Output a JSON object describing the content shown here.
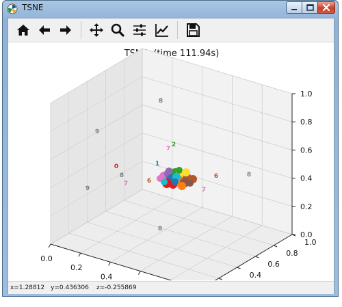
{
  "window": {
    "title": "TSNE",
    "app_icon": "matplotlib-icon",
    "controls": [
      "minimize-icon",
      "maximize-icon",
      "close-icon"
    ]
  },
  "toolbar": {
    "buttons": [
      {
        "name": "home-button",
        "icon": "home-icon"
      },
      {
        "name": "back-button",
        "icon": "arrow-left-icon"
      },
      {
        "name": "forward-button",
        "icon": "arrow-right-icon"
      },
      {
        "name": "pan-button",
        "icon": "move-icon"
      },
      {
        "name": "zoom-button",
        "icon": "magnifier-icon"
      },
      {
        "name": "configure-subplots-button",
        "icon": "sliders-icon"
      },
      {
        "name": "edit-axes-button",
        "icon": "line-chart-icon"
      },
      {
        "name": "save-button",
        "icon": "floppy-disk-icon"
      }
    ]
  },
  "status": {
    "x": "x=1.28812",
    "y": "y=0.436306",
    "z": "z=-0.255869"
  },
  "chart_data": {
    "type": "scatter",
    "title": "TSNE: (time 111.94s)",
    "xlabel": "",
    "ylabel": "",
    "zlabel": "",
    "xlim": [
      0,
      1
    ],
    "ylim": [
      0,
      1
    ],
    "zlim": [
      0,
      1
    ],
    "x_ticks": [
      "0.0",
      "0.2",
      "0.4",
      "0.6",
      "0.8",
      "1.0"
    ],
    "y_ticks": [
      "0.0",
      "0.2",
      "0.4",
      "0.6",
      "0.8",
      "1.0"
    ],
    "z_ticks": [
      "0.0",
      "0.2",
      "0.4",
      "0.6",
      "0.8",
      "1.0"
    ],
    "grid": true,
    "colors": {
      "0": "#e31a1c",
      "1": "#1f78b4",
      "2": "#33a02c",
      "6": "#b15928",
      "7": "#e377c2",
      "8": "#7f7f7f",
      "9": "#7f7f7f"
    },
    "labels": [
      {
        "text": "8"
      },
      {
        "text": "9"
      },
      {
        "text": "7"
      },
      {
        "text": "2"
      },
      {
        "text": "1"
      },
      {
        "text": "0"
      },
      {
        "text": "8"
      },
      {
        "text": "7"
      },
      {
        "text": "6"
      },
      {
        "text": "9"
      },
      {
        "text": "6"
      },
      {
        "text": "8"
      },
      {
        "text": "7"
      },
      {
        "text": "8"
      }
    ],
    "cluster_colors": [
      "#e377c2",
      "#9467bd",
      "#33a02c",
      "#ffdd33",
      "#b15928",
      "#1f78b4",
      "#ff7f0e",
      "#e31a1c",
      "#8c564b",
      "#17becf"
    ]
  }
}
